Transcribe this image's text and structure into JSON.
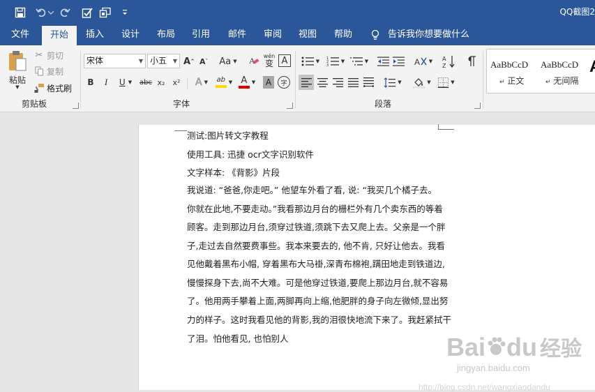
{
  "window": {
    "title": "QQ截图2",
    "quick_access": [
      {
        "icon": "save-icon"
      },
      {
        "icon": "undo-icon"
      },
      {
        "icon": "redo-icon"
      },
      {
        "icon": "spelling-check-icon"
      },
      {
        "icon": "touch-mode-icon"
      },
      {
        "icon": "customize-qat-icon"
      }
    ]
  },
  "tabs": [
    "文件",
    "开始",
    "插入",
    "设计",
    "布局",
    "引用",
    "邮件",
    "审阅",
    "视图",
    "帮助"
  ],
  "active_tab": "开始",
  "tell_me": "告诉我你想要做什么",
  "clipboard": {
    "paste": "粘贴",
    "cut": "剪切",
    "copy": "复制",
    "format_painter": "格式刷",
    "group": "剪贴板"
  },
  "font": {
    "name": "宋体",
    "size": "小五",
    "change_case": "Aa",
    "wen": "wén",
    "wen_char": "变",
    "border_char": "A",
    "bold": "B",
    "italic": "I",
    "underline": "U",
    "strike": "abc",
    "subscript": "x₂",
    "superscript": "x²",
    "effects": "A",
    "highlight": "ab",
    "font_color": "A",
    "shading": "A",
    "enclose": "字",
    "group": "字体"
  },
  "paragraph": {
    "group": "段落"
  },
  "styles": {
    "items": [
      {
        "sample": "AaBbCcD",
        "name": "正文"
      },
      {
        "sample": "AaBbCcD",
        "name": "无间隔"
      }
    ]
  },
  "document": {
    "lines": [
      "测试:图片转文字教程",
      "使用工具: 迅捷 ocr文字识别软件",
      "文字样本: 《背影》片段",
      "我说道: “爸爸,你走吧。” 他望车外看了看, 说: “我买几个橘子去。",
      "你就在此地,不要走动。”我看那边月台的栅栏外有几个卖东西的等着",
      "顾客。走到那边月台,须穿过铁道,须跳下去又爬上去。父亲是一个胖",
      "子,走过去自然要费事些。我本来要去的, 他不肯, 只好让他去。我看",
      "见他戴着黑布小帽, 穿着黑布大马褂,深青布棉袍,蹒田地走到铁道边,",
      "慢慢探身下去,尚不大难。可是他穿过铁道,要爬上那边月台,就不容易",
      "了。他用两手攀着上面,两脚再向上缩,他肥胖的身子向左微倾,显出努",
      "力的样子。这时我看见他的背影,我的泪很快地流下来了。我赶紧拭干",
      "了泪。怕他看见, 也怕别人"
    ]
  },
  "watermark": {
    "brand": "Bai",
    "brand2": "du",
    "jy": "经验",
    "url": "jingyan.baidu.com",
    "url2": "http://blog.csdn.net/wangxiaodandu"
  },
  "colors": {
    "accent": "#2b579a",
    "highlight": "#ffd900",
    "font_red": "#e00000"
  }
}
